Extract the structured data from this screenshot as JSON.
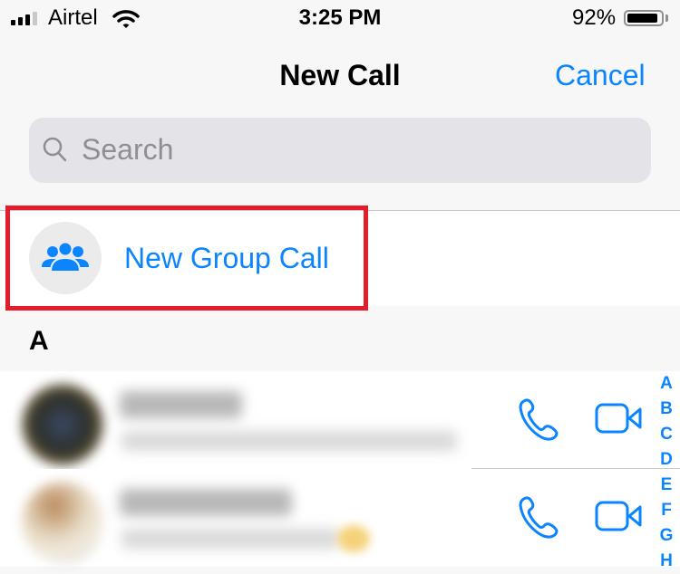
{
  "status_bar": {
    "carrier": "Airtel",
    "time": "3:25 PM",
    "battery_percent_label": "92%",
    "battery_level": 0.92,
    "signal_bars_filled": 3,
    "signal_bars_total": 4,
    "icons": [
      "signal-icon",
      "wifi-icon",
      "battery-icon"
    ]
  },
  "nav": {
    "title": "New Call",
    "cancel_label": "Cancel"
  },
  "search": {
    "placeholder": "Search",
    "value": ""
  },
  "group_call": {
    "label": "New Group Call",
    "icon": "group-icon",
    "highlighted": true
  },
  "sections": [
    {
      "header": "A",
      "contacts": [
        {
          "name": "(blurred)",
          "subtitle": "(blurred)",
          "actions": [
            "voice-call",
            "video-call"
          ]
        },
        {
          "name": "(blurred)",
          "subtitle": "(blurred)",
          "actions": [
            "voice-call",
            "video-call"
          ]
        }
      ]
    }
  ],
  "index_letters": [
    "A",
    "B",
    "C",
    "D",
    "E",
    "F",
    "G",
    "H"
  ],
  "colors": {
    "accent": "#0a84ff",
    "highlight_border": "#e51c2a",
    "search_bg": "#e3e3e8",
    "background": "#f7f7f7"
  }
}
